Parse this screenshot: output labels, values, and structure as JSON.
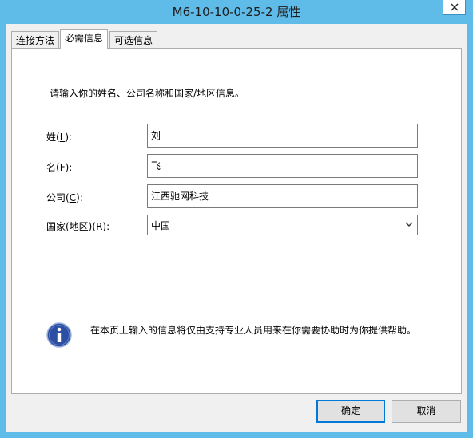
{
  "window": {
    "title": "M6-10-10-0-25-2 属性"
  },
  "tabs": [
    {
      "label": "连接方法",
      "active": false
    },
    {
      "label": "必需信息",
      "active": true
    },
    {
      "label": "可选信息",
      "active": false
    }
  ],
  "form": {
    "instruction": "请输入你的姓名、公司名称和国家/地区信息。",
    "surname": {
      "label": "姓",
      "accel": "L",
      "value": "刘"
    },
    "given_name": {
      "label": "名",
      "accel": "F",
      "value": "飞"
    },
    "company": {
      "label": "公司",
      "accel": "C",
      "value": "江西驰网科技"
    },
    "country": {
      "label": "国家(地区)",
      "accel": "R",
      "value": "中国"
    }
  },
  "info": {
    "text": "在本页上输入的信息将仅由支持专业人员用来在你需要协助时为你提供帮助。"
  },
  "buttons": {
    "ok": "确定",
    "cancel": "取消"
  },
  "colors": {
    "title_bar": "#5fbbe8",
    "accent": "#0078d7",
    "info_icon": "#2d4fa3"
  }
}
